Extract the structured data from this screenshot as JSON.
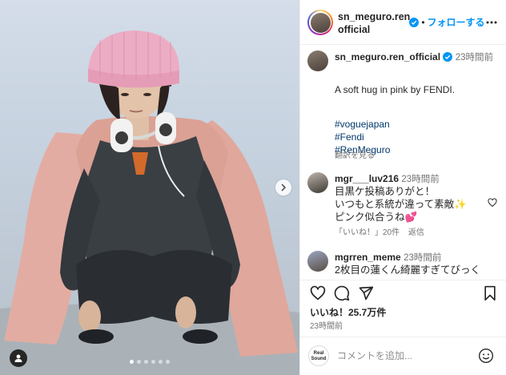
{
  "header": {
    "username_line1": "sn_meguro.ren_",
    "username_line2": "official",
    "separator": "•",
    "follow_label": "フォローする"
  },
  "caption": {
    "username": "sn_meguro.ren_official",
    "time": "23時間前",
    "text": "A soft hug in pink by FENDI.",
    "hashtags": [
      "#voguejapan",
      "#Fendi",
      "#RenMeguro"
    ],
    "translate_label": "翻訳を見る"
  },
  "comments": [
    {
      "username": "mgr___luv216",
      "time": "23時間前",
      "lines": [
        "目黒ケ投稿ありがと！",
        "いつもと系統が違って素敵✨",
        "ピンク似合うね💕"
      ],
      "likes_label": "「いいね！」20件",
      "reply_label": "返信"
    },
    {
      "username": "mgrren_meme",
      "time": "23時間前",
      "lines": [
        "2枚目の蓮くん綺麗すぎてびっく"
      ]
    }
  ],
  "actions": {
    "likes_text": "いいね！25.7万件",
    "posted_time": "23時間前"
  },
  "comment_bar": {
    "realsound_logo": "Real Sound",
    "placeholder": "コメントを追加..."
  },
  "media": {
    "carousel_dots": 6,
    "active_dot": 0
  },
  "colors": {
    "link_blue": "#0095f6",
    "hashtag": "#00376b",
    "verified": "#0095f6",
    "pink_coat": "#e3aca2"
  },
  "icons": [
    "verified-badge-icon",
    "more-options-icon",
    "heart-icon",
    "comment-icon",
    "share-icon",
    "bookmark-icon",
    "emoji-icon",
    "next-arrow-icon",
    "user-tag-icon"
  ]
}
